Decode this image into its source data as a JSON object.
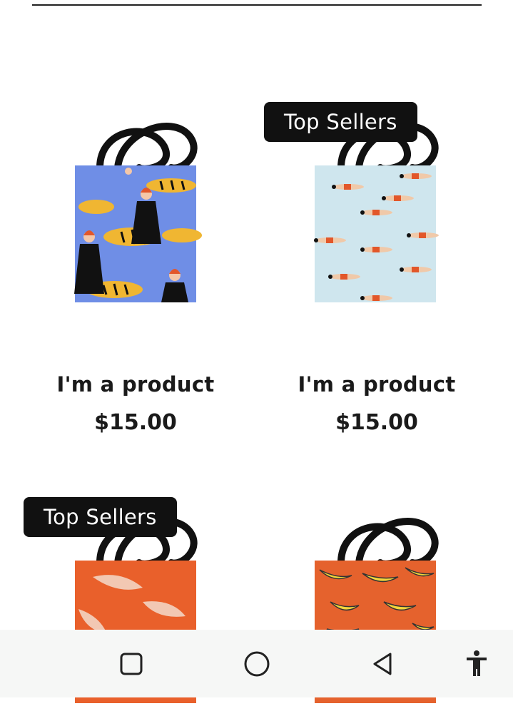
{
  "products": [
    {
      "title": "I'm a product",
      "price": "$15.00",
      "badge": "",
      "pattern": "tigers-and-women",
      "bag_color": "#6f8ee6"
    },
    {
      "title": "I'm a product",
      "price": "$15.00",
      "badge": "Top Sellers",
      "pattern": "swimmers",
      "bag_color": "#cfe6ee"
    },
    {
      "title": "",
      "price": "",
      "badge": "Top Sellers",
      "pattern": "orange-brush",
      "bag_color": "#e9602b"
    },
    {
      "title": "",
      "price": "",
      "badge": "",
      "pattern": "bananas",
      "bag_color": "#e5622d"
    }
  ],
  "navbar": {
    "buttons": [
      "recent-apps-icon",
      "home-icon",
      "back-icon",
      "accessibility-icon"
    ]
  }
}
